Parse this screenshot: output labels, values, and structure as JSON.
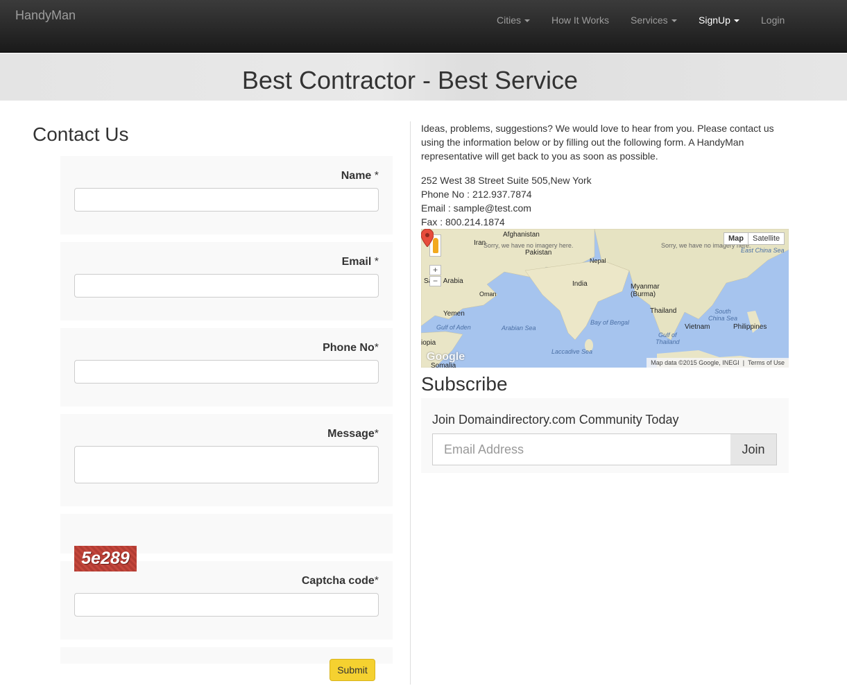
{
  "navbar": {
    "brand": "HandyMan",
    "items": [
      {
        "label": "Cities",
        "dropdown": true
      },
      {
        "label": "How It Works",
        "dropdown": false
      },
      {
        "label": "Services",
        "dropdown": true
      },
      {
        "label": "SignUp",
        "dropdown": true,
        "active": true
      },
      {
        "label": "Login",
        "dropdown": false
      }
    ]
  },
  "banner": {
    "title": "Best Contractor - Best Service"
  },
  "contact": {
    "title": "Contact Us",
    "name_label": "Name",
    "email_label": "Email",
    "phone_label": "Phone No",
    "message_label": "Message",
    "captcha_label": "Captcha code",
    "required_mark": "*",
    "captcha_text": "5e289",
    "submit_label": "Submit"
  },
  "info": {
    "intro": "Ideas, problems, suggestions? We would love to hear from you. Please contact us using the information below or by filling out the following form. A HandyMan representative will get back to you as soon as possible.",
    "address": "252 West 38 Street Suite 505,New York",
    "phone": "Phone No : 212.937.7874",
    "email": "Email : sample@test.com",
    "fax": "Fax : 800.214.1874"
  },
  "map": {
    "type_map": "Map",
    "type_satellite": "Satellite",
    "attribution": "Map data ©2015 Google, INEGI",
    "terms": "Terms of Use",
    "zoom_in": "+",
    "zoom_out": "−",
    "logo": "Google",
    "no_imagery": "Sorry, we have no imagery here.",
    "labels": {
      "afghanistan": "Afghanistan",
      "iran": "Iran",
      "pakistan": "Pakistan",
      "nepal": "Nepal",
      "saudi": "Saudi Arabia",
      "india": "India",
      "myanmar": "Myanmar\n(Burma)",
      "oman": "Oman",
      "yemen": "Yemen",
      "thailand": "Thailand",
      "vietnam": "Vietnam",
      "philippines": "Philippines",
      "ethiopia": "iopia",
      "somalia": "Somalia",
      "aden": "Gulf of Aden",
      "arabian": "Arabian Sea",
      "bengal": "Bay of Bengal",
      "laccadive": "Laccadive Sea",
      "east_china": "East China Sea",
      "south_china": "South\nChina Sea",
      "gulf_thailand": "Gulf of\nThailand"
    },
    "colors": {
      "land": "#e9e5c6",
      "water": "#a6c4ee",
      "pin": "#e74c3c"
    }
  },
  "subscribe": {
    "title": "Subscribe",
    "text": "Join Domaindirectory.com Community Today",
    "placeholder": "Email Address",
    "button": "Join"
  }
}
